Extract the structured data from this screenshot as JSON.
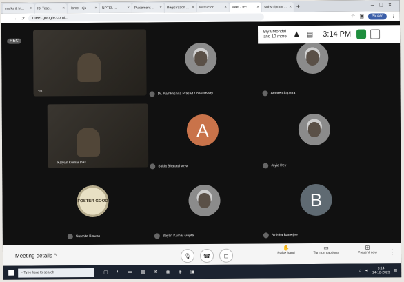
{
  "browser": {
    "tabs": [
      "marks & ht...",
      "ISI Teac...",
      "Home - nju",
      "NPTEL ...",
      "Placement ...",
      "Registration ...",
      "Instructor...",
      "Meet - fcc",
      "Subscription ..."
    ],
    "url": "meet.google.com/...",
    "profile": "Paused"
  },
  "meeting": {
    "rec_label": "REC",
    "overlay": {
      "name_line1": "Biya Mondal",
      "name_line2": "and 10 more",
      "time": "3:14 PM"
    },
    "tiles": [
      {
        "name": "You"
      },
      {
        "name": "Dr. Ramkrishna Prasad Chakraborty"
      },
      {
        "name": "Amarendu patra"
      },
      {
        "name": "Kalyan Kumar Das"
      },
      {
        "name": "Sukla Bhattacharya",
        "letter": "A"
      },
      {
        "name": "Joyia Dey"
      },
      {
        "name": "Susmita Biswas",
        "badge": "FOSTER GOOD"
      },
      {
        "name": "Sayan Kumar Gupta"
      },
      {
        "name": "Bidisha Banerjee",
        "letter": "B"
      }
    ]
  },
  "bottom_bar": {
    "details": "Meeting details",
    "raise_hand": "Raise hand",
    "captions": "Turn on captions",
    "present": "Present now"
  },
  "taskbar": {
    "search_placeholder": "Type here to search",
    "time": "3:14",
    "date": "14-12-2023"
  },
  "colors": {
    "meet_bg": "#111111",
    "accent_green": "#1e8e3e"
  }
}
